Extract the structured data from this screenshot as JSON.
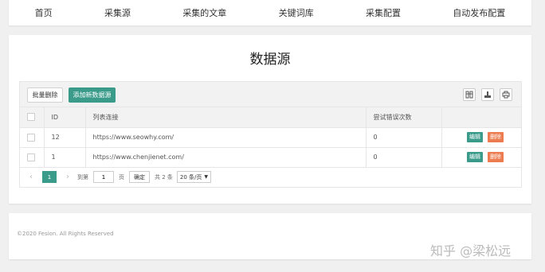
{
  "nav": [
    "首页",
    "采集源",
    "采集的文章",
    "关键词库",
    "采集配置",
    "自动发布配置"
  ],
  "page_title": "数据源",
  "toolbar": {
    "batch_delete": "批量删除",
    "add_source": "添加新数据源",
    "icons": [
      "columns-icon",
      "export-icon",
      "print-icon"
    ]
  },
  "table": {
    "headers": [
      "ID",
      "列表连接",
      "尝试错误次数"
    ],
    "rows": [
      {
        "id": "12",
        "url": "https://www.seowhy.com/",
        "errors": "0",
        "edit": "编辑",
        "delete": "删除"
      },
      {
        "id": "1",
        "url": "https://www.chenjienet.com/",
        "errors": "0",
        "edit": "编辑",
        "delete": "删除"
      }
    ]
  },
  "pager": {
    "current": "1",
    "goto_label": "到第",
    "goto_value": "1",
    "page_label": "页",
    "confirm": "确定",
    "total": "共 2 条",
    "page_size": "20 条/页"
  },
  "footer": "©2020 Fesion. All Rights Reserved",
  "watermark": "知乎 @梁松远",
  "colors": {
    "accent": "#3a9b8b",
    "danger": "#ec7b4f",
    "background": "#f0f0f0"
  }
}
